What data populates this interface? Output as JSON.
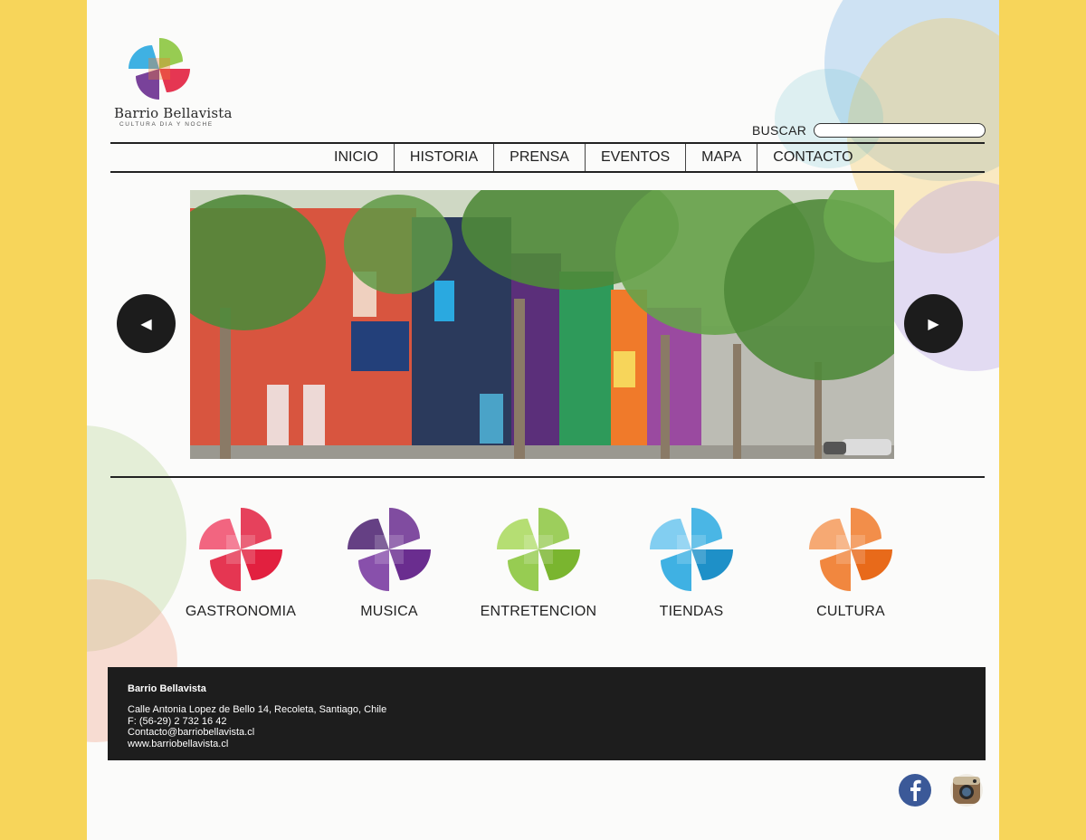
{
  "brand": {
    "name": "Barrio Bellavista",
    "tagline": "CULTURA DIA Y NOCHE",
    "colors": {
      "red": "#e2203f",
      "purple": "#6a2d8f",
      "green": "#8cc63f",
      "blue": "#2aa9e0",
      "orange": "#f07a2a",
      "yellow": "#f7d55a"
    }
  },
  "search": {
    "label": "BUSCAR",
    "value": "",
    "placeholder": ""
  },
  "nav": {
    "items": [
      {
        "label": "INICIO"
      },
      {
        "label": "HISTORIA"
      },
      {
        "label": "PRENSA"
      },
      {
        "label": "EVENTOS"
      },
      {
        "label": "MAPA"
      },
      {
        "label": "CONTACTO"
      }
    ]
  },
  "hero": {
    "image": "street-photo-colorful-facades-trees",
    "prev_icon": "chevron-left-icon",
    "next_icon": "chevron-right-icon"
  },
  "categories": [
    {
      "label": "GASTRONOMIA",
      "color": "#e2203f"
    },
    {
      "label": "MUSICA",
      "color": "#6a2d8f"
    },
    {
      "label": "ENTRETENCION",
      "color": "#8cc63f"
    },
    {
      "label": "TIENDAS",
      "color": "#2aa9e0"
    },
    {
      "label": "CULTURA",
      "color": "#f07a2a"
    }
  ],
  "footer": {
    "title": "Barrio Bellavista",
    "address": "Calle Antonia Lopez de Bello 14, Recoleta, Santiago, Chile",
    "phone": "F: (56-29) 2 732 16 42",
    "email": "Contacto@barriobellavista.cl",
    "web": "www.barriobellavista.cl"
  },
  "social": [
    {
      "icon": "facebook-icon",
      "color": "#3b5998"
    },
    {
      "icon": "instagram-icon",
      "color": "#8a6a4a"
    }
  ]
}
